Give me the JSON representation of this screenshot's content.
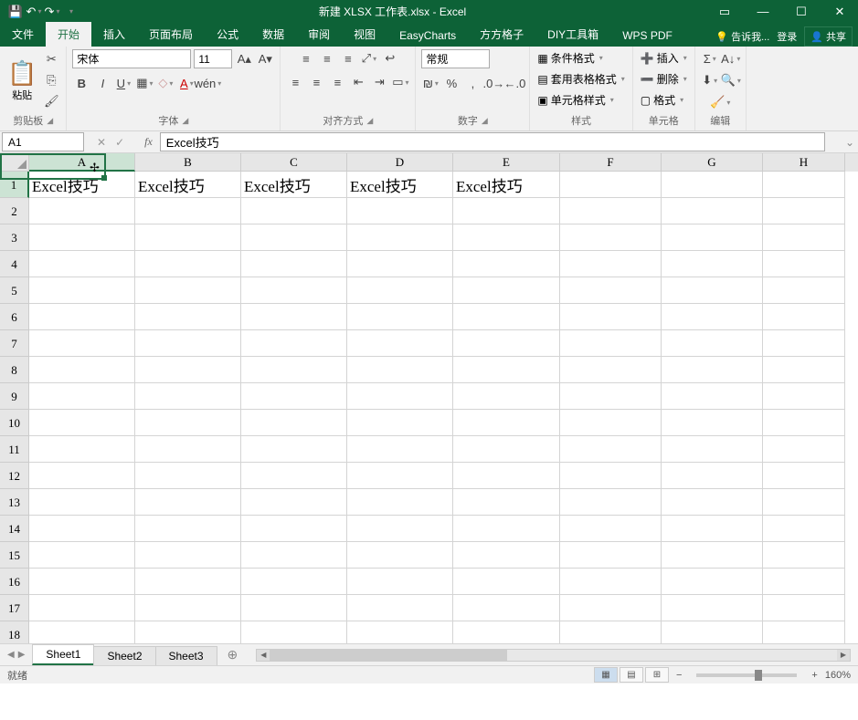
{
  "title": "新建 XLSX 工作表.xlsx - Excel",
  "tabs": {
    "file": "文件",
    "home": "开始",
    "insert": "插入",
    "layout": "页面布局",
    "formulas": "公式",
    "data": "数据",
    "review": "审阅",
    "view": "视图",
    "easycharts": "EasyCharts",
    "fangfang": "方方格子",
    "diy": "DIY工具箱",
    "wpspdf": "WPS PDF"
  },
  "tellme": "告诉我...",
  "signin": "登录",
  "share": "共享",
  "ribbon": {
    "clipboard": {
      "paste": "粘贴",
      "label": "剪贴板"
    },
    "font": {
      "name": "宋体",
      "size": "11",
      "label": "字体"
    },
    "align": {
      "label": "对齐方式"
    },
    "number": {
      "format": "常规",
      "label": "数字"
    },
    "styles": {
      "cond": "条件格式",
      "table": "套用表格格式",
      "cell": "单元格样式",
      "label": "样式"
    },
    "cells": {
      "insert": "插入",
      "delete": "删除",
      "format": "格式",
      "label": "单元格"
    },
    "editing": {
      "label": "编辑"
    }
  },
  "cellref": "A1",
  "formula_value": "Excel技巧",
  "columns": [
    "A",
    "B",
    "C",
    "D",
    "E",
    "F",
    "G",
    "H"
  ],
  "rows": [
    "1",
    "2",
    "3",
    "4",
    "5",
    "6",
    "7",
    "8",
    "9",
    "10",
    "11",
    "12",
    "13",
    "14",
    "15",
    "16",
    "17",
    "18"
  ],
  "celldata": {
    "r1": [
      "Excel技巧",
      "Excel技巧",
      "Excel技巧",
      "Excel技巧",
      "Excel技巧",
      "",
      "",
      ""
    ]
  },
  "sheets": [
    "Sheet1",
    "Sheet2",
    "Sheet3"
  ],
  "status": "就绪",
  "zoom": "160%"
}
